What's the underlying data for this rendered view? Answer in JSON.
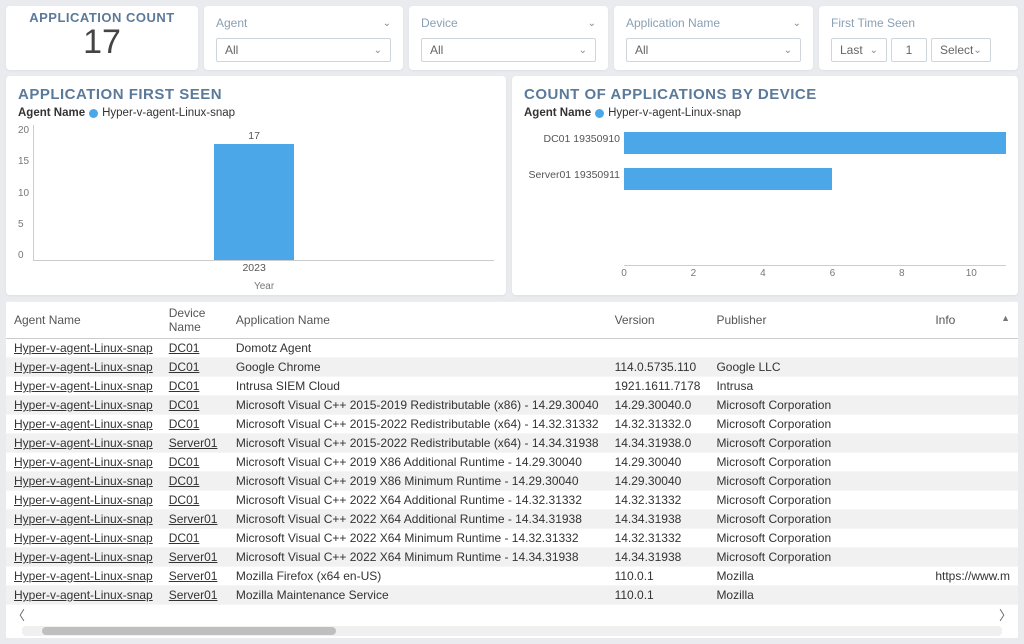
{
  "colors": {
    "accent": "#4ba7e8"
  },
  "kpi": {
    "title": "APPLICATION COUNT",
    "value": "17"
  },
  "filters": {
    "agent": {
      "label": "Agent",
      "value": "All"
    },
    "device": {
      "label": "Device",
      "value": "All"
    },
    "app": {
      "label": "Application Name",
      "value": "All"
    },
    "fts": {
      "label": "First Time Seen",
      "sel1": "Last",
      "mid": "1",
      "sel2": "Select"
    }
  },
  "chart_left": {
    "title": "APPLICATION FIRST SEEN",
    "legend_label": "Agent Name",
    "series_name": "Hyper-v-agent-Linux-snap",
    "ylabel": "",
    "axis_sub_title": "Year"
  },
  "chart_right": {
    "title": "COUNT OF APPLICATIONS BY DEVICE",
    "legend_label": "Agent Name",
    "series_name": "Hyper-v-agent-Linux-snap"
  },
  "chart_data": [
    {
      "type": "bar",
      "title": "APPLICATION FIRST SEEN",
      "xlabel": "Year",
      "ylabel": "",
      "ylim": [
        0,
        20
      ],
      "yticks": [
        0,
        5,
        10,
        15,
        20
      ],
      "categories": [
        "2023"
      ],
      "series": [
        {
          "name": "Hyper-v-agent-Linux-snap",
          "values": [
            17
          ]
        }
      ]
    },
    {
      "type": "bar",
      "orientation": "horizontal",
      "title": "COUNT OF APPLICATIONS BY DEVICE",
      "xlabel": "",
      "ylabel": "",
      "xlim": [
        0,
        11
      ],
      "xticks": [
        0,
        2,
        4,
        6,
        8,
        10
      ],
      "categories": [
        "DC01 19350910",
        "Server01 19350911"
      ],
      "series": [
        {
          "name": "Hyper-v-agent-Linux-snap",
          "values": [
            11,
            6
          ]
        }
      ]
    }
  ],
  "table": {
    "columns": [
      "Agent Name",
      "Device Name",
      "Application Name",
      "Version",
      "Publisher",
      "Info"
    ],
    "sort_col_index": 5,
    "rows": [
      {
        "agent": "Hyper-v-agent-Linux-snap",
        "device": "DC01",
        "app": "Domotz Agent",
        "ver": "",
        "pub": "",
        "info": ""
      },
      {
        "agent": "Hyper-v-agent-Linux-snap",
        "device": "DC01",
        "app": "Google Chrome",
        "ver": "114.0.5735.110",
        "pub": "Google LLC",
        "info": ""
      },
      {
        "agent": "Hyper-v-agent-Linux-snap",
        "device": "DC01",
        "app": "Intrusa SIEM Cloud",
        "ver": "1921.1611.7178",
        "pub": "Intrusa",
        "info": ""
      },
      {
        "agent": "Hyper-v-agent-Linux-snap",
        "device": "DC01",
        "app": "Microsoft Visual C++ 2015-2019 Redistributable (x86) - 14.29.30040",
        "ver": "14.29.30040.0",
        "pub": "Microsoft Corporation",
        "info": ""
      },
      {
        "agent": "Hyper-v-agent-Linux-snap",
        "device": "DC01",
        "app": "Microsoft Visual C++ 2015-2022 Redistributable (x64) - 14.32.31332",
        "ver": "14.32.31332.0",
        "pub": "Microsoft Corporation",
        "info": ""
      },
      {
        "agent": "Hyper-v-agent-Linux-snap",
        "device": "Server01",
        "app": "Microsoft Visual C++ 2015-2022 Redistributable (x64) - 14.34.31938",
        "ver": "14.34.31938.0",
        "pub": "Microsoft Corporation",
        "info": ""
      },
      {
        "agent": "Hyper-v-agent-Linux-snap",
        "device": "DC01",
        "app": "Microsoft Visual C++ 2019 X86 Additional Runtime - 14.29.30040",
        "ver": "14.29.30040",
        "pub": "Microsoft Corporation",
        "info": ""
      },
      {
        "agent": "Hyper-v-agent-Linux-snap",
        "device": "DC01",
        "app": "Microsoft Visual C++ 2019 X86 Minimum Runtime - 14.29.30040",
        "ver": "14.29.30040",
        "pub": "Microsoft Corporation",
        "info": ""
      },
      {
        "agent": "Hyper-v-agent-Linux-snap",
        "device": "DC01",
        "app": "Microsoft Visual C++ 2022 X64 Additional Runtime - 14.32.31332",
        "ver": "14.32.31332",
        "pub": "Microsoft Corporation",
        "info": ""
      },
      {
        "agent": "Hyper-v-agent-Linux-snap",
        "device": "Server01",
        "app": "Microsoft Visual C++ 2022 X64 Additional Runtime - 14.34.31938",
        "ver": "14.34.31938",
        "pub": "Microsoft Corporation",
        "info": ""
      },
      {
        "agent": "Hyper-v-agent-Linux-snap",
        "device": "DC01",
        "app": "Microsoft Visual C++ 2022 X64 Minimum Runtime - 14.32.31332",
        "ver": "14.32.31332",
        "pub": "Microsoft Corporation",
        "info": ""
      },
      {
        "agent": "Hyper-v-agent-Linux-snap",
        "device": "Server01",
        "app": "Microsoft Visual C++ 2022 X64 Minimum Runtime - 14.34.31938",
        "ver": "14.34.31938",
        "pub": "Microsoft Corporation",
        "info": ""
      },
      {
        "agent": "Hyper-v-agent-Linux-snap",
        "device": "Server01",
        "app": "Mozilla Firefox (x64 en-US)",
        "ver": "110.0.1",
        "pub": "Mozilla",
        "info": "https://www.m"
      },
      {
        "agent": "Hyper-v-agent-Linux-snap",
        "device": "Server01",
        "app": "Mozilla Maintenance Service",
        "ver": "110.0.1",
        "pub": "Mozilla",
        "info": ""
      }
    ]
  }
}
